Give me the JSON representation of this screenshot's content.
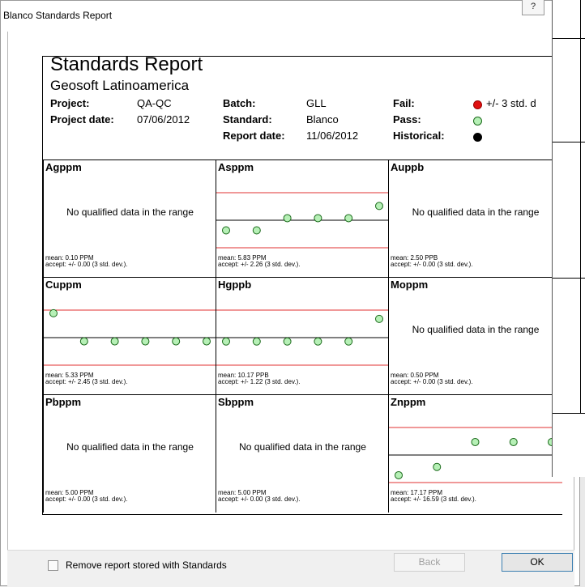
{
  "window": {
    "title": "Blanco Standards Report",
    "help_label": "?"
  },
  "report": {
    "title": "Standards Report",
    "company": "Geosoft Latinoamerica",
    "project_label": "Project:",
    "project_value": "QA-QC",
    "project_date_label": "Project date:",
    "project_date_value": "07/06/2012",
    "batch_label": "Batch:",
    "batch_value": "GLL",
    "standard_label": "Standard:",
    "standard_value": "Blanco",
    "report_date_label": "Report date:",
    "report_date_value": "11/06/2012",
    "fail_label": "Fail:",
    "fail_text": "+/- 3 std. d",
    "pass_label": "Pass:",
    "historical_label": "Historical:"
  },
  "colors": {
    "fail": "#e01010",
    "pass": "#b6f0b6",
    "historical": "#000000",
    "limit_line": "#e03030"
  },
  "cells": [
    {
      "name": "agppm",
      "title": "Agppm",
      "nodata": "No qualified data in the range",
      "mean": "mean: 0.10 PPM",
      "accept": "accept: +/- 0.00 (3 std. dev.).",
      "points": []
    },
    {
      "name": "asppm",
      "title": "Asppm",
      "nodata": "",
      "mean": "mean: 5.83 PPM",
      "accept": "accept: +/- 2.26 (3 std. dev.).",
      "points": [
        5,
        5,
        6,
        6,
        6,
        7
      ]
    },
    {
      "name": "auppb",
      "title": "Auppb",
      "nodata": "No qualified data in the range",
      "mean": "mean: 2.50 PPB",
      "accept": "accept: +/- 0.00 (3 std. dev.).",
      "points": []
    },
    {
      "name": "cuppm",
      "title": "Cuppm",
      "nodata": "",
      "mean": "mean: 5.33 PPM",
      "accept": "accept: +/- 2.45 (3 std. dev.).",
      "points": [
        7.5,
        5,
        5,
        5,
        5,
        5
      ]
    },
    {
      "name": "hgppb",
      "title": "Hgppb",
      "nodata": "",
      "mean": "mean: 10.17 PPB",
      "accept": "accept: +/- 1.22 (3 std. dev.).",
      "points": [
        10,
        10,
        10,
        10,
        10,
        11
      ]
    },
    {
      "name": "moppm",
      "title": "Moppm",
      "nodata": "No qualified data in the range",
      "mean": "mean: 0.50 PPM",
      "accept": "accept: +/- 0.00 (3 std. dev.).",
      "points": []
    },
    {
      "name": "pbppm",
      "title": "Pbppm",
      "nodata": "No qualified data in the range",
      "mean": "mean: 5.00 PPM",
      "accept": "accept: +/- 0.00 (3 std. dev.).",
      "points": []
    },
    {
      "name": "sbppm",
      "title": "Sbppm",
      "nodata": "No qualified data in the range",
      "mean": "mean: 5.00 PPM",
      "accept": "accept: +/- 0.00 (3 std. dev.).",
      "points": []
    },
    {
      "name": "znppm",
      "title": "Znppm",
      "nodata": "",
      "mean": "mean: 17.17 PPM",
      "accept": "accept: +/- 16.59 (3 std. dev.).",
      "points": [
        5,
        10,
        25,
        25,
        25
      ]
    }
  ],
  "footer": {
    "remove_label": "Remove report stored with Standards",
    "back_label": "Back",
    "ok_label": "OK"
  }
}
